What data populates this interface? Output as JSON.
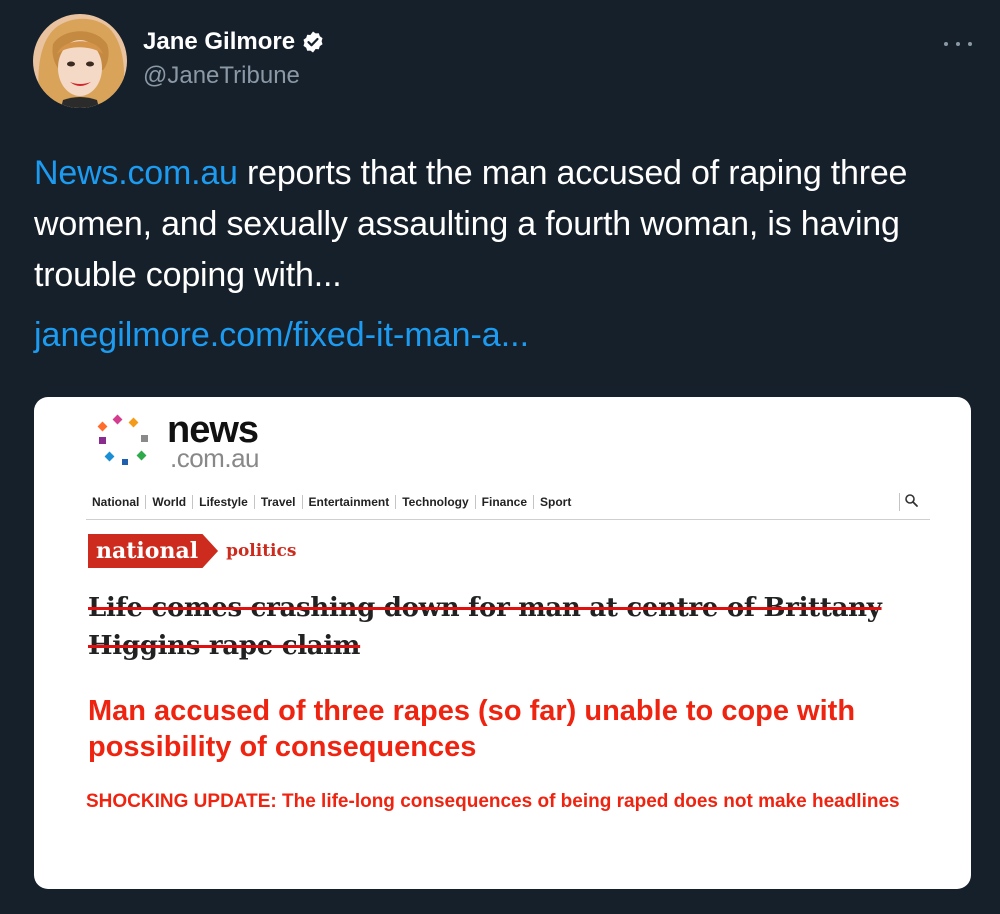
{
  "author": {
    "name": "Jane Gilmore",
    "handle": "@JaneTribune"
  },
  "tweet": {
    "link_text": "News.com.au",
    "body": " reports that the man accused of raping three women, and sexually assaulting a fourth woman, is having trouble coping with...",
    "url_text": "janegilmore.com/fixed-it-man-a..."
  },
  "card": {
    "logo_main": "news",
    "logo_sub": ".com.au",
    "nav": [
      "National",
      "World",
      "Lifestyle",
      "Travel",
      "Entertainment",
      "Technology",
      "Finance",
      "Sport"
    ],
    "tag_primary": "national",
    "tag_secondary": "politics",
    "old_headline": "Life comes crashing down for man at centre of Brittany Higgins rape claim",
    "new_headline": "Man accused of three rapes (so far) unable to cope with possibility of consequences",
    "update": "SHOCKING UPDATE: The life-long consequences of being raped does not make headlines"
  },
  "colors": {
    "background": "#15202b",
    "link": "#1d9bf0",
    "secondary_text": "#8b98a5",
    "news_red": "#cc2b1d",
    "fixed_red": "#ee2411"
  },
  "icons": [
    "avatar",
    "verified-badge-icon",
    "more-options-icon",
    "search-icon"
  ]
}
